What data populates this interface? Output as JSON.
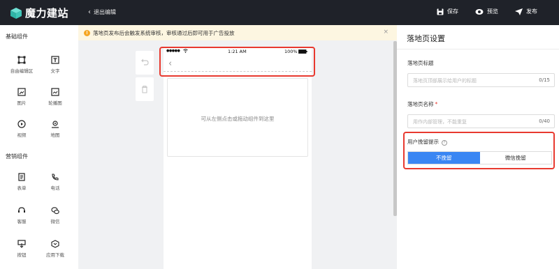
{
  "header": {
    "logo_text": "魔力建站",
    "exit_label": "退出编辑",
    "save_label": "保存",
    "preview_label": "预览",
    "publish_label": "发布"
  },
  "left_panel": {
    "basic_title": "基础组件",
    "basic_items": [
      {
        "label": "自由编辑区",
        "icon": "free-edit-icon"
      },
      {
        "label": "文字",
        "icon": "text-icon"
      },
      {
        "label": "图片",
        "icon": "image-icon"
      },
      {
        "label": "轮播图",
        "icon": "carousel-icon"
      },
      {
        "label": "视频",
        "icon": "video-icon"
      },
      {
        "label": "地图",
        "icon": "map-icon"
      }
    ],
    "marketing_title": "营销组件",
    "marketing_items": [
      {
        "label": "表单",
        "icon": "form-icon"
      },
      {
        "label": "电话",
        "icon": "phone-icon"
      },
      {
        "label": "客服",
        "icon": "customer-service-icon"
      },
      {
        "label": "微信",
        "icon": "wechat-icon"
      },
      {
        "label": "按钮",
        "icon": "button-icon"
      },
      {
        "label": "应用下载",
        "icon": "app-download-icon"
      }
    ]
  },
  "notice": {
    "text": "落地页发布后会触发系统审核，审核通过后即可用于广告投放",
    "close": "×"
  },
  "canvas": {
    "status_time": "1:21 AM",
    "status_battery": "100%",
    "status_signal": "●●●●●",
    "back_arrow": "‹",
    "drop_hint": "可从左侧点击或拖动组件到这里"
  },
  "right_panel": {
    "title": "落地页设置",
    "page_title_label": "落地页标题",
    "page_title_placeholder": "落地页顶部展示给用户的标题",
    "page_title_count": "0/15",
    "page_name_label": "落地页名称",
    "page_name_required": "*",
    "page_name_placeholder": "用作内部管理，不能重复",
    "page_name_count": "0/40",
    "retain_label": "用户挽留提示",
    "retain_help": "?",
    "retain_options": [
      "不挽留",
      "微信挽留"
    ],
    "retain_selected": "不挽留"
  },
  "colors": {
    "topbar": "#1f2229",
    "accent": "#3a86f3",
    "notice_bg": "#fdf6e1",
    "notice_icon": "#f5a623",
    "highlight": "#e8392f",
    "logo_cube": "#3fc6b8"
  }
}
